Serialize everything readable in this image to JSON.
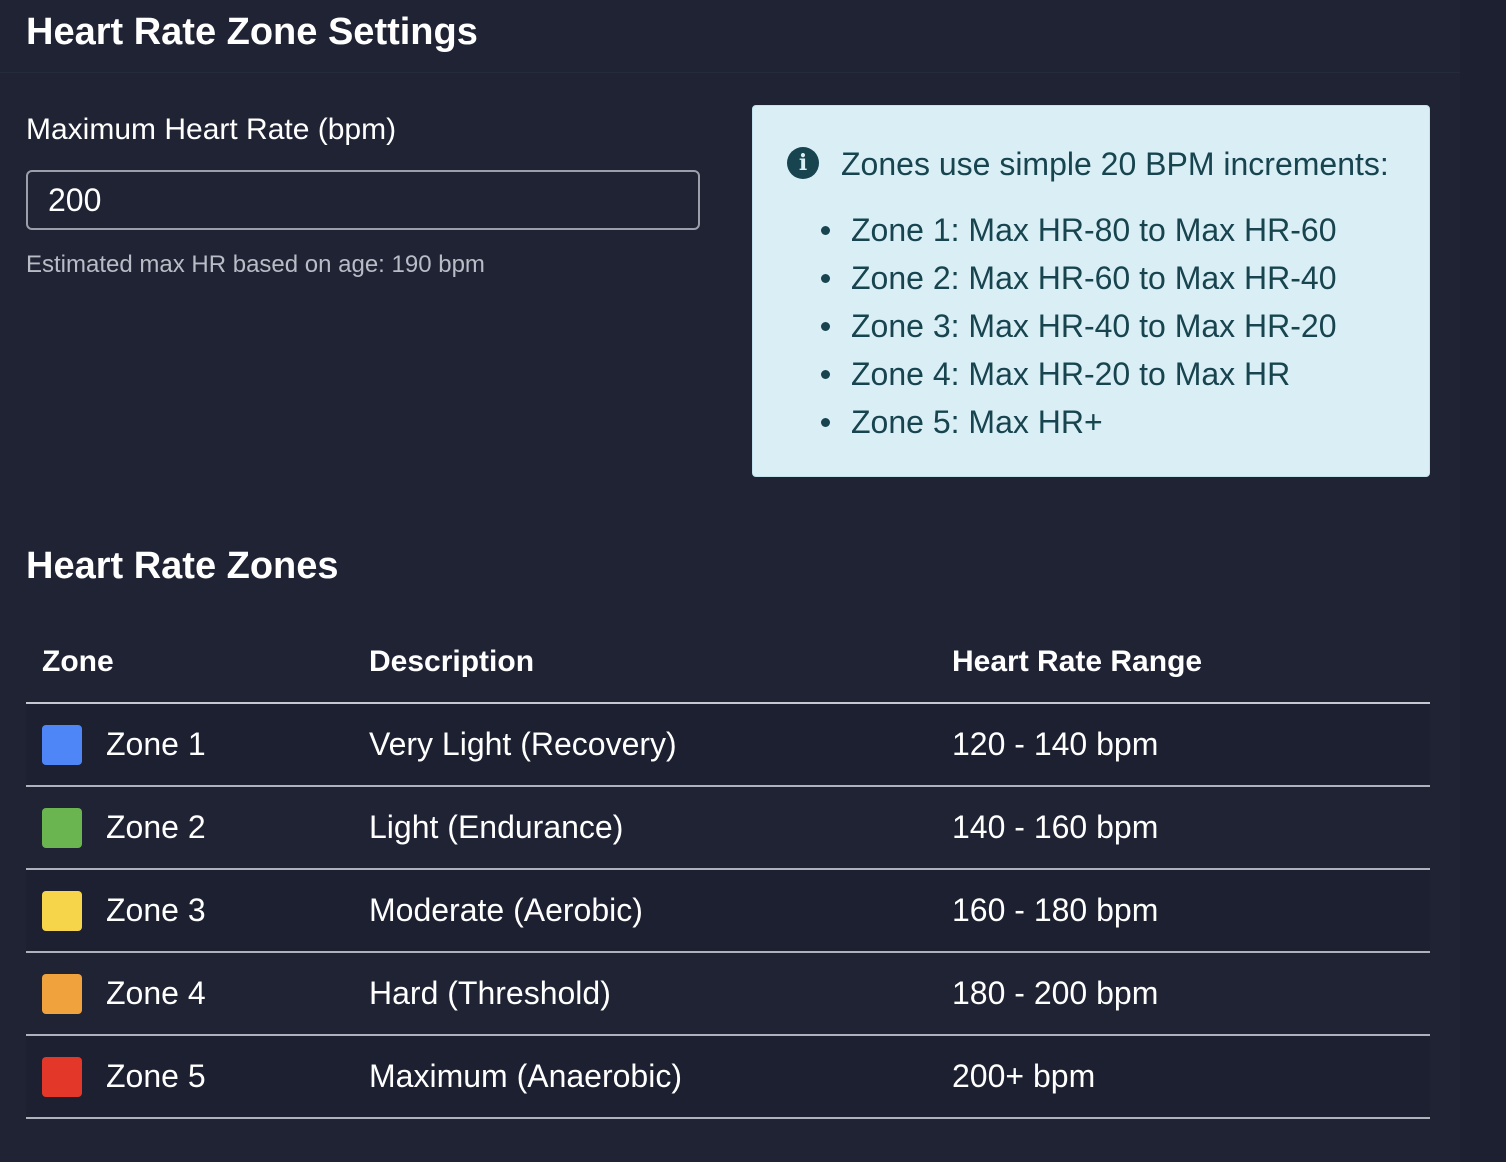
{
  "header": {
    "title": "Heart Rate Zone Settings"
  },
  "max_hr": {
    "label": "Maximum Heart Rate (bpm)",
    "value": "200",
    "hint": "Estimated max HR based on age: 190 bpm"
  },
  "info": {
    "icon": "info-circle-icon",
    "title": "Zones use simple 20 BPM increments:",
    "items": [
      "Zone 1: Max HR-80 to Max HR-60",
      "Zone 2: Max HR-60 to Max HR-40",
      "Zone 3: Max HR-40 to Max HR-20",
      "Zone 4: Max HR-20 to Max HR",
      "Zone 5: Max HR+"
    ]
  },
  "zones": {
    "title": "Heart Rate Zones",
    "columns": [
      "Zone",
      "Description",
      "Heart Rate Range"
    ],
    "rows": [
      {
        "zone": "Zone 1",
        "description": "Very Light (Recovery)",
        "range": "120 - 140 bpm",
        "color": "#4f86f7"
      },
      {
        "zone": "Zone 2",
        "description": "Light (Endurance)",
        "range": "140 - 160 bpm",
        "color": "#6ab550"
      },
      {
        "zone": "Zone 3",
        "description": "Moderate (Aerobic)",
        "range": "160 - 180 bpm",
        "color": "#f7d54a"
      },
      {
        "zone": "Zone 4",
        "description": "Hard (Threshold)",
        "range": "180 - 200 bpm",
        "color": "#f0a23c"
      },
      {
        "zone": "Zone 5",
        "description": "Maximum (Anaerobic)",
        "range": "200+ bpm",
        "color": "#e3372a"
      }
    ]
  }
}
